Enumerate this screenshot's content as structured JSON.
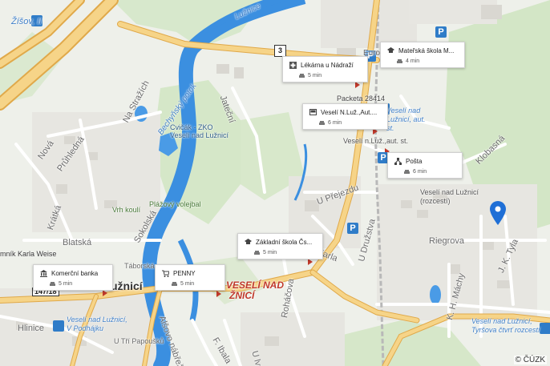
{
  "map": {
    "copyright": "© ČÚZK",
    "road_shield": "3",
    "road_number": "147/18",
    "street_labels": {
      "lucnice": "Lužnice",
      "nastrazich": "Na Stražích",
      "jatecni": "Jateční",
      "nova": "Nová",
      "pruhledna": "Průhledná",
      "kratka": "Krátká",
      "blatska": "Blatská",
      "sokolska": "Sokolská",
      "uprejezdu": "U Přejezdu",
      "udruzstva": "U Družstva",
      "karla": "Karla",
      "rohacova": "Roháčova",
      "riegrova": "Riegrova",
      "jktyla": "J. K. Tyla",
      "khmachy": "K. H. Máchy",
      "hlinice": "Hlinice",
      "klobasna": "Klobasná",
      "taborska": "Táborská",
      "alesovo": "Alšovo nábřeží",
      "fiibala": "F. Ibala",
      "ulvu": "U lvu",
      "utripapousku": "U Tří Papoušků",
      "mnikkarla": "mník Karla Weise",
      "uvo": "Uvo",
      "lucniciplace": "Lužnicí",
      "zisov": "Žíšov, II",
      "eurc": "Euro",
      "packeta": "Packeta 28414"
    },
    "places": {
      "cvicak": "Cvičák - ZKO Veselí nad Lužnicí",
      "vrhkouli": "Vrh koulí",
      "plazovy": "Plážový volejbal",
      "bechyne": "Bechyňský potok",
      "veselinad": "Veselí nad Lužnicí, aut. st.",
      "velesinrozcesti": "Veselí nad Lužnicí (rozcestí)",
      "veselipodhajku": "Veselí nad Lužnicí, V Podhájku",
      "veselityrsova": "Veselí nad Lužnicí, Tyršova čtvrť rozcestí",
      "veselilucnic": "Veselí n.Luž.,aut. st."
    },
    "town_names": {
      "lucnici": "d Lužnicí",
      "veselinad": "VESELÍ NAD",
      "znici": "ŽNICÍ"
    },
    "pois": [
      {
        "name": "Lékárna u Nádraží",
        "time": "5 min",
        "icon": "pharmacy-icon"
      },
      {
        "name": "Mateřská škola M...",
        "time": "4 min",
        "icon": "school-icon"
      },
      {
        "name": "Veselí N.Luž.,Aut....",
        "time": "6 min",
        "icon": "bus-icon"
      },
      {
        "name": "Pošta",
        "time": "6 min",
        "icon": "post-icon"
      },
      {
        "name": "Základní škola Čs...",
        "time": "5 min",
        "icon": "school-icon"
      },
      {
        "name": "Komerční banka",
        "time": "5 min",
        "icon": "bank-icon"
      },
      {
        "name": "PENNY",
        "time": "5 min",
        "icon": "shop-icon"
      }
    ],
    "colors": {
      "background": "#eef0ea",
      "green": "#cfe3c2",
      "water": "#3b8fe0",
      "main_road": "#f6d488",
      "road_edge": "#e0a94a",
      "pin": "#1f6fd6"
    }
  }
}
